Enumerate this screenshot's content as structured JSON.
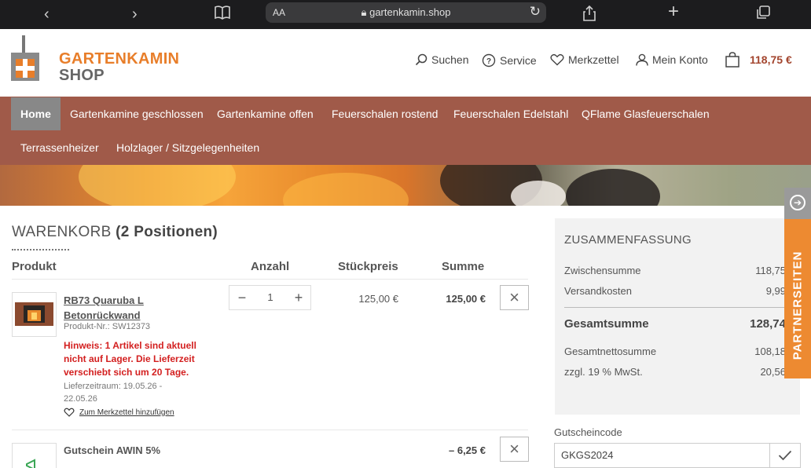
{
  "browser": {
    "text_size": "AA",
    "url": "gartenkamin.shop"
  },
  "brand": {
    "line1": "GARTENKAMIN",
    "line2": "SHOP",
    "accent": "#e87e2a",
    "nav_color": "#a05a49"
  },
  "header_nav": {
    "search": "Suchen",
    "service": "Service",
    "wishlist": "Merkzettel",
    "account": "Mein Konto",
    "cart_total": "118,75 €"
  },
  "main_nav": {
    "items": [
      "Home",
      "Gartenkamine geschlossen",
      "Gartenkamine offen",
      "Feuerschalen rostend",
      "Feuerschalen Edelstahl",
      "QFlame Glasfeuerschalen",
      "Terrassenheizer",
      "Holzlager / Sitzgelegenheiten"
    ]
  },
  "cart": {
    "title": "WARENKORB",
    "count": "(2 Positionen)",
    "headers": {
      "product": "Produkt",
      "qty": "Anzahl",
      "unit_price": "Stückpreis",
      "sum": "Summe"
    },
    "items": [
      {
        "name_line1": "RB73 Quaruba L",
        "name_line2": "Betonrückwand",
        "sku": "Produkt-Nr.: SW12373",
        "warning": "Hinweis: 1 Artikel sind aktuell nicht auf Lager. Die Lieferzeit verschiebt sich um 20 Tage.",
        "delivery": "Lieferzeitraum: 19.05.26 - 22.05.26",
        "wishlist_link": "Zum Merkzettel hinzufügen",
        "quantity": "1",
        "unit_price": "125,00 €",
        "sum": "125,00 €"
      },
      {
        "name": "Gutschein AWIN 5%",
        "sum": "– 6,25 €"
      }
    ]
  },
  "summary": {
    "title": "ZUSAMMENFASSUNG",
    "subtotal_label": "Zwischensumme",
    "subtotal": "118,75",
    "shipping_label": "Versandkosten",
    "shipping": "9,99",
    "total_label": "Gesamtsumme",
    "total": "128,74",
    "net_label": "Gesamtnettosumme",
    "net": "108,18",
    "vat_label": "zzgl. 19 % MwSt.",
    "vat": "20,56"
  },
  "coupon": {
    "label": "Gutscheincode",
    "value": "GKGS2024"
  },
  "partner_tab": {
    "label": "PARTNERSEITEN"
  }
}
